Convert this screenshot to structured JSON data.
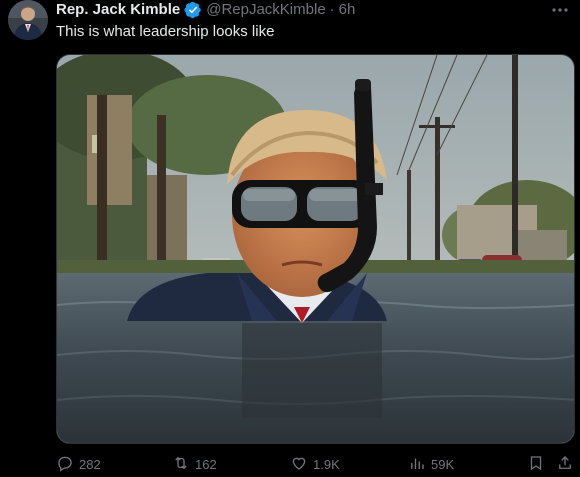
{
  "author": {
    "display_name": "Rep. Jack Kimble",
    "handle": "@RepJackKimble",
    "separator": "·",
    "time": "6h",
    "verified": true
  },
  "tweet": {
    "text": "This is what leadership looks like"
  },
  "actions": {
    "replies": "282",
    "reposts": "162",
    "likes": "1.9K",
    "views": "59K"
  },
  "colors": {
    "background": "#000000",
    "text": "#e7e9ea",
    "muted": "#71767b",
    "verified_badge": "#1d9bf0"
  },
  "icons": [
    "more-icon",
    "verified-badge-icon",
    "reply-icon",
    "repost-icon",
    "like-icon",
    "views-icon",
    "bookmark-icon",
    "share-icon"
  ]
}
